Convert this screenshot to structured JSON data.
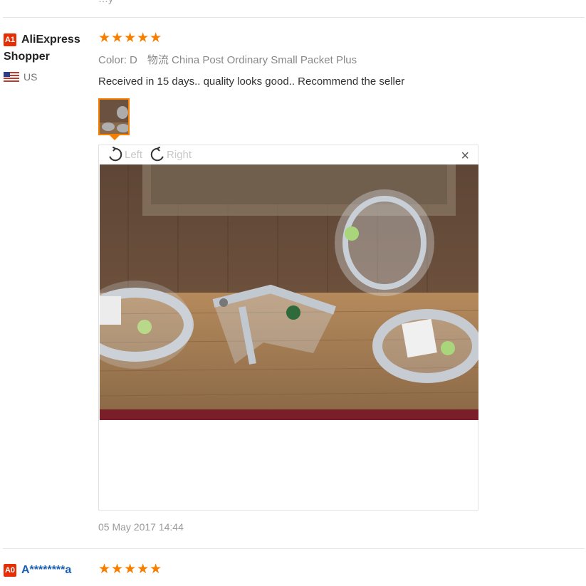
{
  "reviews": [
    {
      "badge": "A1",
      "user_name": "AliExpress Shopper",
      "country": "US",
      "stars": "★★★★★",
      "color_key": "Color:",
      "color_value": "D",
      "shipping": "物流 China Post Ordinary Small Packet Plus",
      "text": "Received in 15 days.. quality looks good.. Recommend the seller",
      "viewer": {
        "left_label": "Left",
        "right_label": "Right",
        "close": "×"
      },
      "date": "05 May 2017 14:44"
    },
    {
      "badge": "A0",
      "user_name": "A********a",
      "stars": "★★★★★"
    }
  ],
  "colors": {
    "accent": "#f77f00",
    "badge": "#e62e04"
  }
}
